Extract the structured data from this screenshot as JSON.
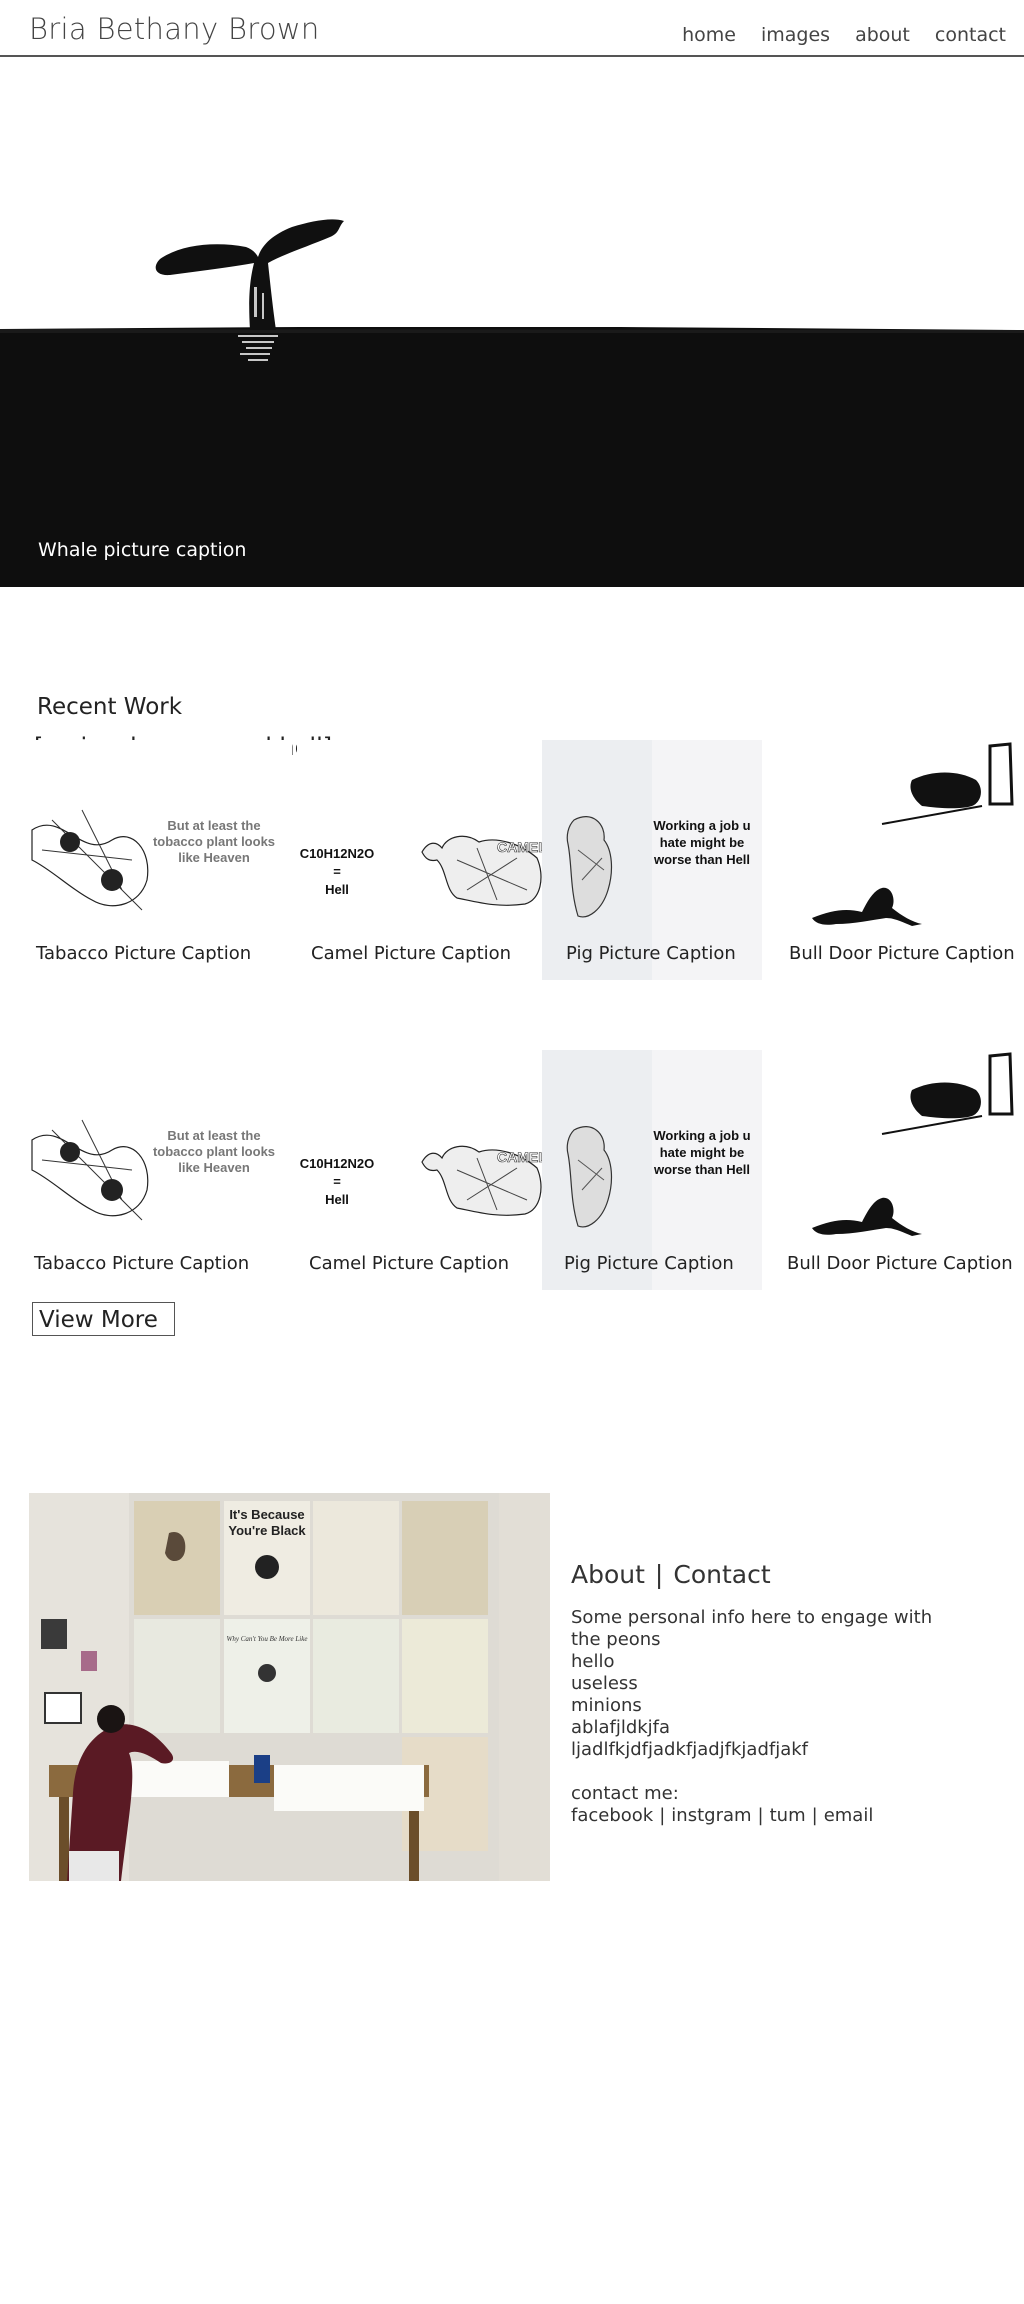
{
  "header": {
    "site_title": "Bria Bethany Brown",
    "nav": [
      "home",
      "images",
      "about",
      "contact"
    ]
  },
  "hero": {
    "caption": "Whale picture caption"
  },
  "recent": {
    "title": "Recent Work",
    "series": "[series: heaven and hell]",
    "rows": [
      {
        "captions": [
          "Tabacco Picture Caption",
          "Camel Picture Caption",
          "Pig Picture Caption",
          "Bull Door Picture Caption"
        ]
      },
      {
        "captions": [
          "Tabacco Picture Caption",
          "Camel Picture Caption",
          "Pig Picture Caption",
          "Bull Door Picture Caption"
        ]
      }
    ],
    "artwork_text": {
      "tobacco": [
        "But at least the",
        "tobacco plant looks",
        "like Heaven"
      ],
      "camel_formula": "C10H12N2O",
      "camel_eq": "=",
      "camel_result": "Hell",
      "camel_label": "CAMEL",
      "pig": [
        "Working a job u",
        "hate might be",
        "worse than Hell"
      ]
    },
    "view_more": "View More"
  },
  "studio": {
    "poster_text": [
      "It's Because",
      "You're Black"
    ],
    "poster_caption": "Why Can't You Be More Like"
  },
  "about": {
    "heading_about": "About",
    "heading_sep": "|",
    "heading_contact": "Contact",
    "lines": [
      "Some personal info here to engage with",
      "the peons",
      "hello",
      "useless",
      "minions",
      "ablafjldkjfa",
      "ljadlfkjdfjadkfjadjfkjadfjakf"
    ],
    "contact_label": "contact me:",
    "links": [
      "facebook",
      "instgram",
      "tum",
      "email"
    ],
    "link_sep": "|"
  },
  "colors": {
    "text": "#333333",
    "hero_dark": "#0d0d0d",
    "white": "#ffffff"
  }
}
